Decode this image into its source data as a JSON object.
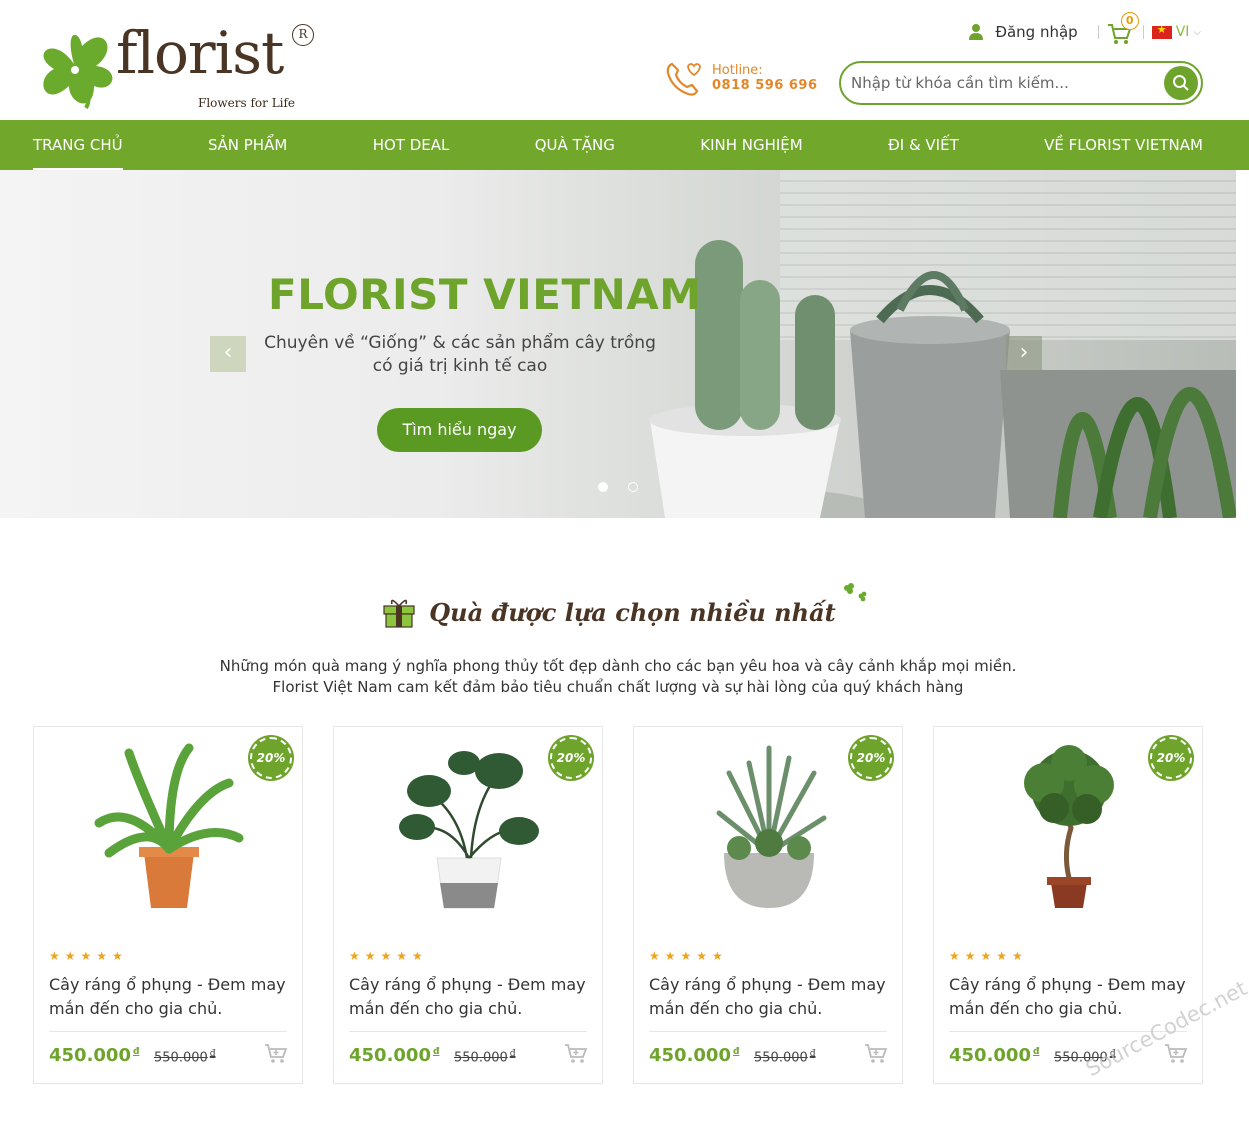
{
  "brand": {
    "name": "florist",
    "tagline": "Flowers for Life",
    "registered": "R"
  },
  "topbar": {
    "login_label": "Đăng nhập",
    "cart_count": "0",
    "language": "VI"
  },
  "hotline": {
    "label": "Hotline:",
    "number": "0818 596 696"
  },
  "search": {
    "placeholder": "Nhập từ khóa cần tìm kiếm..."
  },
  "nav": {
    "items": [
      {
        "label": "TRANG CHỦ",
        "active": true
      },
      {
        "label": "SẢN PHẨM"
      },
      {
        "label": "HOT DEAL"
      },
      {
        "label": "QUÀ TẶNG"
      },
      {
        "label": "KINH NGHIỆM"
      },
      {
        "label": "ĐI & VIẾT"
      },
      {
        "label": "VỀ FLORIST VIETNAM"
      }
    ]
  },
  "hero": {
    "title": "FLORIST VIETNAM",
    "subtitle_line1": "Chuyên về “Giống” & các sản phẩm cây trồng",
    "subtitle_line2": "có giá trị kinh tế cao",
    "cta": "Tìm hiểu ngay",
    "prev": "‹",
    "next": "›"
  },
  "section": {
    "title": "Quà được lựa chọn nhiều nhất",
    "desc_line1": "Những món quà mang ý nghĩa phong thủy tốt đẹp dành cho các bạn yêu hoa và cây cảnh khắp mọi miền.",
    "desc_line2": "Florist Việt Nam cam kết đảm bảo tiêu chuẩn chất lượng và sự hài lòng của quý khách hàng"
  },
  "products": [
    {
      "badge": "20%",
      "stars": "★★★★★",
      "name": "Cây ráng ổ phụng - Đem may mắn đến cho gia chủ.",
      "price": "450.000",
      "old_price": "550.000",
      "currency": "đ"
    },
    {
      "badge": "20%",
      "stars": "★★★★★",
      "name": "Cây ráng ổ phụng - Đem may mắn đến cho gia chủ.",
      "price": "450.000",
      "old_price": "550.000",
      "currency": "đ"
    },
    {
      "badge": "20%",
      "stars": "★★★★★",
      "name": "Cây ráng ổ phụng - Đem may mắn đến cho gia chủ.",
      "price": "450.000",
      "old_price": "550.000",
      "currency": "đ"
    },
    {
      "badge": "20%",
      "stars": "★★★★★",
      "name": "Cây ráng ổ phụng - Đem may mắn đến cho gia chủ.",
      "price": "450.000",
      "old_price": "550.000",
      "currency": "đ"
    }
  ],
  "watermark": "SourceCodec.net",
  "colors": {
    "primary": "#71a82c",
    "accent": "#e3872a",
    "brown": "#4a3424"
  }
}
